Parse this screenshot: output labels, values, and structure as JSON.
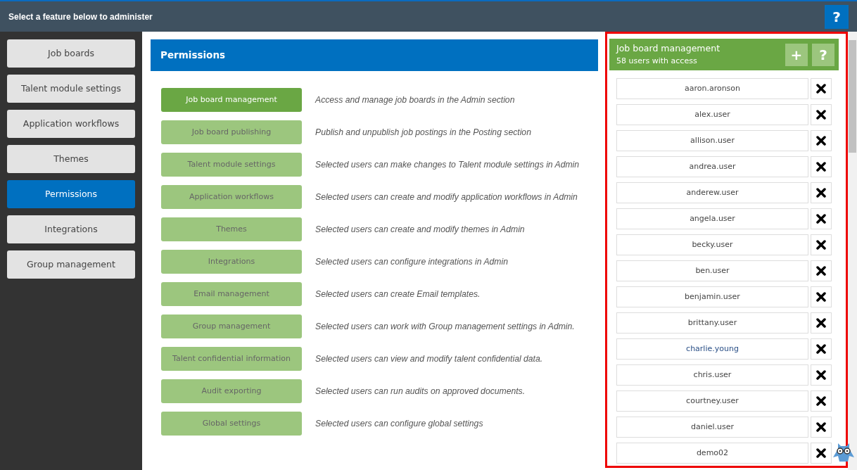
{
  "header": {
    "title": "Select a feature below to administer",
    "help": "?"
  },
  "sidebar": {
    "items": [
      {
        "label": "Job boards",
        "selected": false
      },
      {
        "label": "Talent module settings",
        "selected": false
      },
      {
        "label": "Application workflows",
        "selected": false
      },
      {
        "label": "Themes",
        "selected": false
      },
      {
        "label": "Permissions",
        "selected": true
      },
      {
        "label": "Integrations",
        "selected": false
      },
      {
        "label": "Group management",
        "selected": false
      }
    ]
  },
  "main": {
    "title": "Permissions",
    "permissions": [
      {
        "label": "Job board management",
        "selected": true,
        "description": "Access and manage job boards in the Admin section"
      },
      {
        "label": "Job board publishing",
        "selected": false,
        "description": "Publish and unpublish job postings in the Posting section"
      },
      {
        "label": "Talent module settings",
        "selected": false,
        "description": "Selected users can make changes to Talent module settings in Admin"
      },
      {
        "label": "Application workflows",
        "selected": false,
        "description": "Selected users can create and modify application workflows in Admin"
      },
      {
        "label": "Themes",
        "selected": false,
        "description": "Selected users can create and modify themes in Admin"
      },
      {
        "label": "Integrations",
        "selected": false,
        "description": "Selected users can configure integrations in Admin"
      },
      {
        "label": "Email management",
        "selected": false,
        "description": "Selected users can create Email templates."
      },
      {
        "label": "Group management",
        "selected": false,
        "description": "Selected users can work with Group management settings in Admin."
      },
      {
        "label": "Talent confidential information",
        "selected": false,
        "description": "Selected users can view and modify talent confidential data."
      },
      {
        "label": "Audit exporting",
        "selected": false,
        "description": "Selected users can run audits on approved documents."
      },
      {
        "label": "Global settings",
        "selected": false,
        "description": "Selected users can configure global settings"
      }
    ]
  },
  "access_panel": {
    "title": "Job board management",
    "subtitle": "58 users with access",
    "add": "+",
    "help": "?",
    "users": [
      {
        "name": "aaron.aronson",
        "highlighted": false
      },
      {
        "name": "alex.user",
        "highlighted": false
      },
      {
        "name": "allison.user",
        "highlighted": false
      },
      {
        "name": "andrea.user",
        "highlighted": false
      },
      {
        "name": "anderew.user",
        "highlighted": false
      },
      {
        "name": "angela.user",
        "highlighted": false
      },
      {
        "name": "becky.user",
        "highlighted": false
      },
      {
        "name": "ben.user",
        "highlighted": false
      },
      {
        "name": "benjamin.user",
        "highlighted": false
      },
      {
        "name": "brittany.user",
        "highlighted": false
      },
      {
        "name": "charlie.young",
        "highlighted": true
      },
      {
        "name": "chris.user",
        "highlighted": false
      },
      {
        "name": "courtney.user",
        "highlighted": false
      },
      {
        "name": "daniel.user",
        "highlighted": false
      },
      {
        "name": "demo02",
        "highlighted": false
      }
    ]
  }
}
